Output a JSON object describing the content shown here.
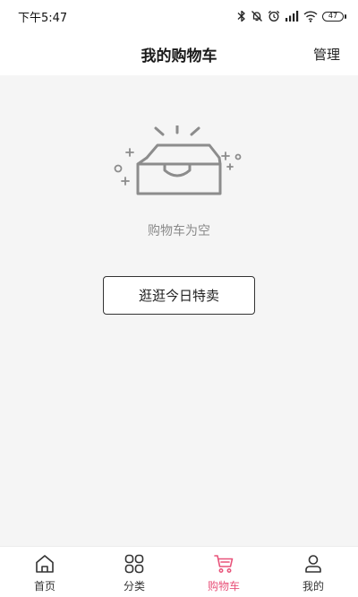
{
  "status_bar": {
    "time": "下午5:47",
    "battery_level": "47",
    "icons": [
      "bluetooth-icon",
      "silent-bell-icon",
      "alarm-icon",
      "signal-icon",
      "wifi-icon",
      "battery-icon"
    ]
  },
  "header": {
    "title": "我的购物车",
    "manage_label": "管理"
  },
  "empty_state": {
    "icon": "empty-box-icon",
    "message": "购物车为空",
    "button_label": "逛逛今日特卖"
  },
  "tab_bar": {
    "active_color": "#e8537a",
    "items": [
      {
        "label": "首页",
        "icon": "home-icon",
        "active": false
      },
      {
        "label": "分类",
        "icon": "category-grid-icon",
        "active": false
      },
      {
        "label": "购物车",
        "icon": "cart-icon",
        "active": true
      },
      {
        "label": "我的",
        "icon": "profile-icon",
        "active": false
      }
    ]
  }
}
